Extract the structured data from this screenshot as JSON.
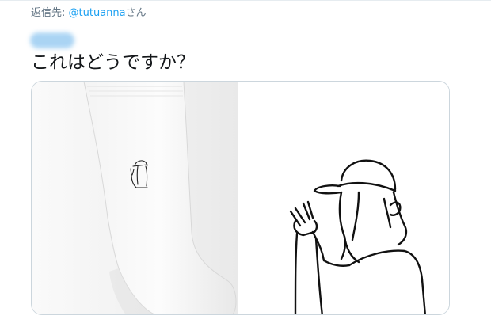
{
  "reply": {
    "prefix": "返信先: ",
    "mention": "@tutuanna",
    "suffix": "さん"
  },
  "tweet": {
    "text": "これはどうですか？"
  },
  "media": {
    "left_image": "sock-product-photo",
    "right_image": "peace-sign-girl-line-drawing"
  }
}
